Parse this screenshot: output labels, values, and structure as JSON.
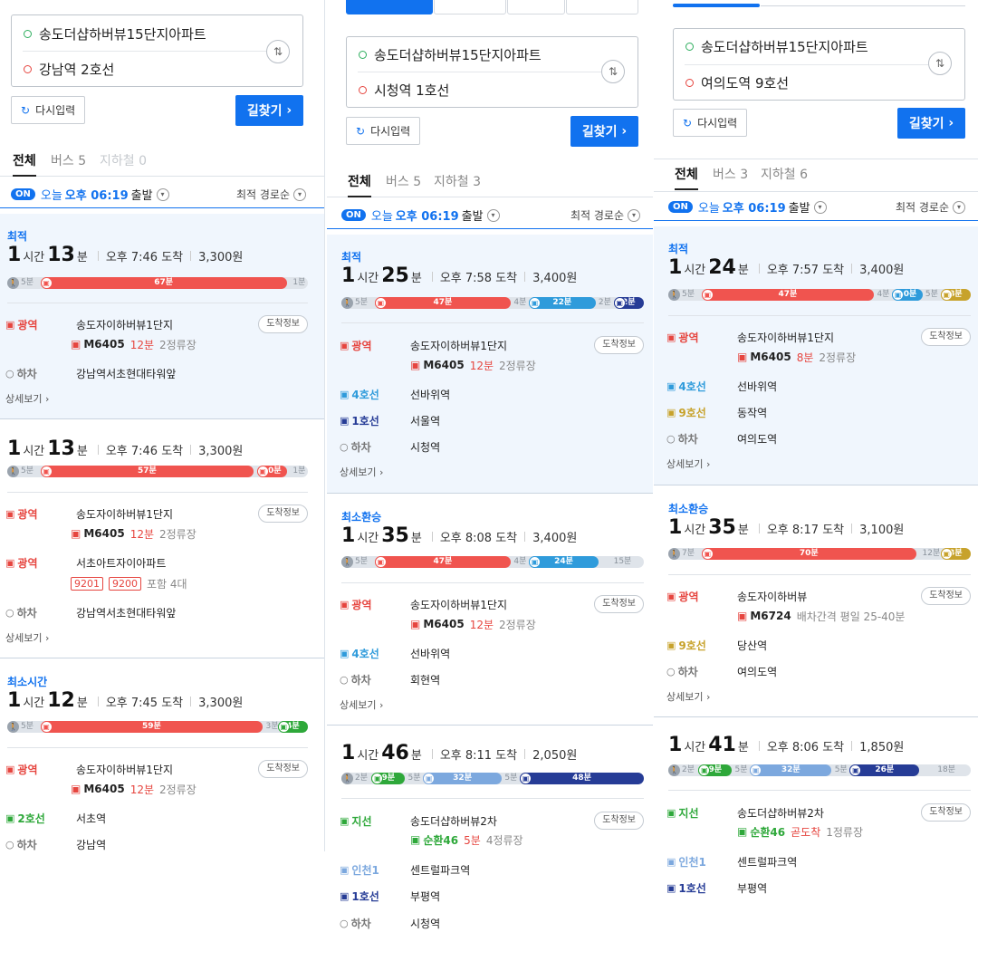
{
  "colors": {
    "accent": "#1172ef",
    "bus_red": "#e6453f",
    "line2": "#2ea83a",
    "line4": "#2f9bdb",
    "line1": "#263c96",
    "line9": "#c7a22b",
    "incheon1": "#7ca8de"
  },
  "common": {
    "reset_label": "다시입력",
    "search_label": "길찾기",
    "search_chevron": "›",
    "swap_glyph": "⇅",
    "on_badge": "ON",
    "depart_today": "오늘",
    "depart_time": "오후 06:19",
    "depart_suffix": "출발",
    "sort_label": "최적 경로순",
    "detail_label": "상세보기",
    "arrival_info_label": "도착정보",
    "hour_unit": "시간",
    "min_unit": "분"
  },
  "panels": [
    {
      "origin": "송도더샵하버뷰15단지아파트",
      "destination": "강남역 2호선",
      "tabs": [
        {
          "label": "전체"
        },
        {
          "label": "버스 5"
        },
        {
          "label": "지하철 0"
        }
      ],
      "routes": [
        {
          "tag": "최적",
          "hours": "1",
          "mins": "13",
          "arrival": "오후 7:46 도착",
          "fare": "3,300원",
          "bar": {
            "walk_start": "5분",
            "segments": [
              {
                "label": "67분",
                "color": "#f0544f",
                "start": 0.11,
                "end": 0.93
              }
            ],
            "labels": [
              {
                "text": "1분",
                "pos": 0.95
              }
            ]
          },
          "steps": [
            {
              "type": "bus",
              "mode": "광역",
              "mode_color": "#e6453f",
              "stop": "송도자이하버뷰1단지",
              "info": true,
              "sub": {
                "number": "M6405",
                "wait": "12분",
                "stops": "2정류장"
              }
            },
            {
              "type": "alight",
              "mode": "하차",
              "stop": "강남역서초현대타워앞"
            }
          ]
        },
        {
          "tag": "",
          "hours": "1",
          "mins": "13",
          "arrival": "오후 7:46 도착",
          "fare": "3,300원",
          "bar": {
            "walk_start": "5분",
            "segments": [
              {
                "label": "57분",
                "color": "#f0544f",
                "start": 0.11,
                "end": 0.82
              },
              {
                "label": "10분",
                "color": "#f0544f",
                "start": 0.83,
                "end": 0.93
              }
            ],
            "labels": [
              {
                "text": "1분",
                "pos": 0.95
              }
            ]
          },
          "steps": [
            {
              "type": "bus",
              "mode": "광역",
              "mode_color": "#e6453f",
              "stop": "송도자이하버뷰1단지",
              "info": true,
              "sub": {
                "number": "M6405",
                "wait": "12분",
                "stops": "2정류장"
              }
            },
            {
              "type": "bus",
              "mode": "광역",
              "mode_color": "#e6453f",
              "stop": "서초아트자이아파트",
              "info": false,
              "sub": {
                "tags": [
                  "9201",
                  "9200"
                ],
                "extra": "포함 4대"
              }
            },
            {
              "type": "alight",
              "mode": "하차",
              "stop": "강남역서초현대타워앞"
            }
          ]
        },
        {
          "tag": "최소시간",
          "hours": "1",
          "mins": "12",
          "arrival": "오후 7:45 도착",
          "fare": "3,300원",
          "bar": {
            "walk_start": "5분",
            "segments": [
              {
                "label": "59분",
                "color": "#f0544f",
                "start": 0.11,
                "end": 0.85
              },
              {
                "label": "4분",
                "color": "#2ea83a",
                "start": 0.9,
                "end": 1.0
              }
            ],
            "labels": [
              {
                "text": "3분",
                "pos": 0.86
              }
            ]
          },
          "steps": [
            {
              "type": "bus",
              "mode": "광역",
              "mode_color": "#e6453f",
              "stop": "송도자이하버뷰1단지",
              "info": true,
              "sub": {
                "number": "M6405",
                "wait": "12분",
                "stops": "2정류장"
              }
            },
            {
              "type": "subway",
              "mode": "2호선",
              "mode_color": "#2ea83a",
              "stop": "서초역"
            },
            {
              "type": "alight",
              "mode": "하차",
              "stop": "강남역"
            }
          ]
        }
      ]
    },
    {
      "origin": "송도더샵하버뷰15단지아파트",
      "destination": "시청역 1호선",
      "tabs": [
        {
          "label": "전체"
        },
        {
          "label": "버스 5"
        },
        {
          "label": "지하철 3"
        }
      ],
      "routes": [
        {
          "tag": "최적",
          "hours": "1",
          "mins": "25",
          "arrival": "오후 7:58 도착",
          "fare": "3,400원",
          "bar": {
            "walk_start": "5분",
            "segments": [
              {
                "label": "47분",
                "color": "#f0544f",
                "start": 0.11,
                "end": 0.56
              },
              {
                "label": "22분",
                "color": "#2f9bdb",
                "start": 0.62,
                "end": 0.84
              },
              {
                "label": "2분",
                "color": "#263c96",
                "start": 0.9,
                "end": 1.0
              }
            ],
            "labels": [
              {
                "text": "4분",
                "pos": 0.57
              },
              {
                "text": "2분",
                "pos": 0.85
              }
            ]
          },
          "steps": [
            {
              "type": "bus",
              "mode": "광역",
              "mode_color": "#e6453f",
              "stop": "송도자이하버뷰1단지",
              "info": true,
              "sub": {
                "number": "M6405",
                "wait": "12분",
                "stops": "2정류장"
              }
            },
            {
              "type": "subway",
              "mode": "4호선",
              "mode_color": "#2f9bdb",
              "stop": "선바위역"
            },
            {
              "type": "subway",
              "mode": "1호선",
              "mode_color": "#263c96",
              "stop": "서울역"
            },
            {
              "type": "alight",
              "mode": "하차",
              "stop": "시청역"
            }
          ]
        },
        {
          "tag": "최소환승",
          "hours": "1",
          "mins": "35",
          "arrival": "오후 8:08 도착",
          "fare": "3,400원",
          "bar": {
            "walk_start": "5분",
            "segments": [
              {
                "label": "47분",
                "color": "#f0544f",
                "start": 0.11,
                "end": 0.56
              },
              {
                "label": "24분",
                "color": "#2f9bdb",
                "start": 0.62,
                "end": 0.85
              }
            ],
            "labels": [
              {
                "text": "4분",
                "pos": 0.57
              },
              {
                "text": "15분",
                "pos": 0.9
              }
            ]
          },
          "steps": [
            {
              "type": "bus",
              "mode": "광역",
              "mode_color": "#e6453f",
              "stop": "송도자이하버뷰1단지",
              "info": true,
              "sub": {
                "number": "M6405",
                "wait": "12분",
                "stops": "2정류장"
              }
            },
            {
              "type": "subway",
              "mode": "4호선",
              "mode_color": "#2f9bdb",
              "stop": "선바위역"
            },
            {
              "type": "alight",
              "mode": "하차",
              "stop": "회현역"
            }
          ]
        },
        {
          "tag": "",
          "hours": "1",
          "mins": "46",
          "arrival": "오후 8:11 도착",
          "fare": "2,050원",
          "bar": {
            "walk_start": "2분",
            "segments": [
              {
                "label": "9분",
                "color": "#2ea83a",
                "start": 0.1,
                "end": 0.21
              },
              {
                "label": "32분",
                "color": "#7ca8de",
                "start": 0.27,
                "end": 0.53
              },
              {
                "label": "48분",
                "color": "#263c96",
                "start": 0.59,
                "end": 1.0
              }
            ],
            "labels": [
              {
                "text": "5분",
                "pos": 0.22
              },
              {
                "text": "5분",
                "pos": 0.54
              }
            ]
          },
          "steps": [
            {
              "type": "bus",
              "mode": "지선",
              "mode_color": "#2ea83a",
              "stop": "송도더샵하버뷰2차",
              "info": true,
              "sub": {
                "number": "순환46",
                "number_color": "#2ea83a",
                "wait": "5분",
                "stops": "4정류장"
              }
            },
            {
              "type": "subway",
              "mode": "인천1",
              "mode_color": "#7ca8de",
              "stop": "센트럴파크역"
            },
            {
              "type": "subway",
              "mode": "1호선",
              "mode_color": "#263c96",
              "stop": "부평역"
            },
            {
              "type": "alight",
              "mode": "하차",
              "stop": "시청역"
            }
          ]
        }
      ]
    },
    {
      "origin": "송도더샵하버뷰15단지아파트",
      "destination": "여의도역 9호선",
      "tabs": [
        {
          "label": "전체"
        },
        {
          "label": "버스 3"
        },
        {
          "label": "지하철 6"
        }
      ],
      "routes": [
        {
          "tag": "최적",
          "hours": "1",
          "mins": "24",
          "arrival": "오후 7:57 도착",
          "fare": "3,400원",
          "bar": {
            "walk_start": "5분",
            "segments": [
              {
                "label": "47분",
                "color": "#f0544f",
                "start": 0.11,
                "end": 0.68
              },
              {
                "label": "10분",
                "color": "#2f9bdb",
                "start": 0.74,
                "end": 0.84
              },
              {
                "label": "8분",
                "color": "#c7a22b",
                "start": 0.9,
                "end": 1.0
              }
            ],
            "labels": [
              {
                "text": "4분",
                "pos": 0.69
              },
              {
                "text": "5분",
                "pos": 0.85
              }
            ]
          },
          "steps": [
            {
              "type": "bus",
              "mode": "광역",
              "mode_color": "#e6453f",
              "stop": "송도자이하버뷰1단지",
              "info": true,
              "sub": {
                "number": "M6405",
                "wait": "8분",
                "stops": "2정류장"
              }
            },
            {
              "type": "subway",
              "mode": "4호선",
              "mode_color": "#2f9bdb",
              "stop": "선바위역"
            },
            {
              "type": "subway",
              "mode": "9호선",
              "mode_color": "#c7a22b",
              "stop": "동작역"
            },
            {
              "type": "alight",
              "mode": "하차",
              "stop": "여의도역"
            }
          ]
        },
        {
          "tag": "최소환승",
          "hours": "1",
          "mins": "35",
          "arrival": "오후 8:17 도착",
          "fare": "3,100원",
          "bar": {
            "walk_start": "7분",
            "segments": [
              {
                "label": "70분",
                "color": "#f0544f",
                "start": 0.11,
                "end": 0.82
              },
              {
                "label": "3분",
                "color": "#c7a22b",
                "start": 0.9,
                "end": 1.0
              }
            ],
            "labels": [
              {
                "text": "12분",
                "pos": 0.84
              }
            ]
          },
          "steps": [
            {
              "type": "bus",
              "mode": "광역",
              "mode_color": "#e6453f",
              "stop": "송도자이하버뷰",
              "info": true,
              "sub": {
                "number": "M6724",
                "gray": "배차간격 평일 25-40분"
              }
            },
            {
              "type": "subway",
              "mode": "9호선",
              "mode_color": "#c7a22b",
              "stop": "당산역"
            },
            {
              "type": "alight",
              "mode": "하차",
              "stop": "여의도역"
            }
          ]
        },
        {
          "tag": "",
          "hours": "1",
          "mins": "41",
          "arrival": "오후 8:06 도착",
          "fare": "1,850원",
          "bar": {
            "walk_start": "2분",
            "segments": [
              {
                "label": "9분",
                "color": "#2ea83a",
                "start": 0.1,
                "end": 0.21
              },
              {
                "label": "32분",
                "color": "#7ca8de",
                "start": 0.27,
                "end": 0.54
              },
              {
                "label": "26분",
                "color": "#263c96",
                "start": 0.6,
                "end": 0.83
              }
            ],
            "labels": [
              {
                "text": "5분",
                "pos": 0.22
              },
              {
                "text": "5분",
                "pos": 0.55
              },
              {
                "text": "18분",
                "pos": 0.89
              }
            ]
          },
          "steps": [
            {
              "type": "bus",
              "mode": "지선",
              "mode_color": "#2ea83a",
              "stop": "송도더샵하버뷰2차",
              "info": true,
              "sub": {
                "number": "순환46",
                "number_color": "#2ea83a",
                "wait": "곧도착",
                "stops": "1정류장"
              }
            },
            {
              "type": "subway",
              "mode": "인천1",
              "mode_color": "#7ca8de",
              "stop": "센트럴파크역"
            },
            {
              "type": "subway",
              "mode": "1호선",
              "mode_color": "#263c96",
              "stop": "부평역"
            }
          ]
        }
      ]
    }
  ]
}
